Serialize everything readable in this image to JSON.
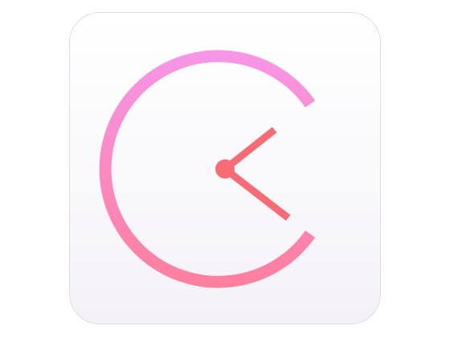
{
  "app_icon": {
    "icon": "clock-icon",
    "colors": {
      "tile_top": "#ffffff",
      "tile_bottom": "#f4f2f7",
      "tile_border": "#dcdcdf",
      "ring_top": "#f795e6",
      "ring_bottom": "#ff7f9f",
      "hands": "#f76b75"
    },
    "clock": {
      "hour_hand_angle_deg": 55,
      "minute_hand_angle_deg": 126,
      "ring_gap": "right"
    }
  }
}
